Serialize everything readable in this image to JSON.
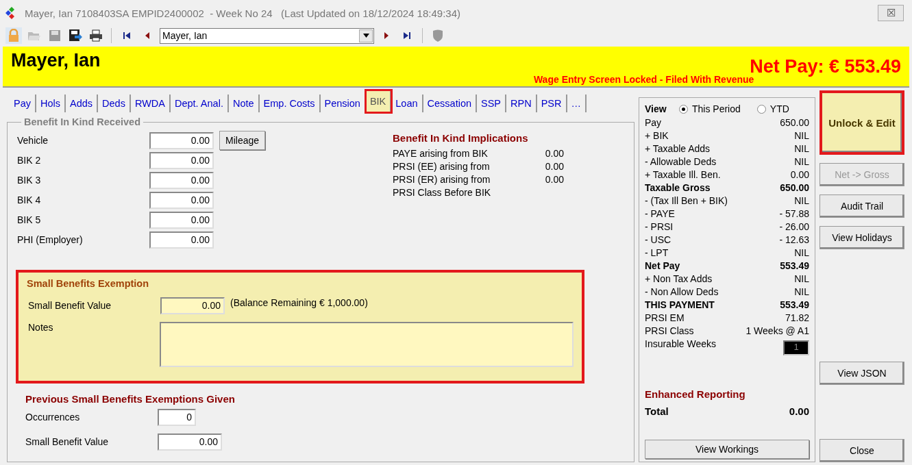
{
  "window": {
    "title": "Mayer, Ian 7108403SA EMPID2400002  - Week No 24   (Last Updated on 18/12/2024 18:49:34)",
    "close": "☒"
  },
  "toolbar": {
    "employee": "Mayer, Ian"
  },
  "banner": {
    "name": "Mayer, Ian",
    "net_pay": "Net Pay: € 553.49",
    "status": "Wage Entry Screen Locked - Filed With Revenue"
  },
  "tabs": [
    {
      "label": "Pay",
      "selected": false,
      "highlighted": false
    },
    {
      "label": "Hols",
      "selected": false,
      "highlighted": false
    },
    {
      "label": "Adds",
      "selected": false,
      "highlighted": false
    },
    {
      "label": "Deds",
      "selected": false,
      "highlighted": false
    },
    {
      "label": "RWDA",
      "selected": false,
      "highlighted": false
    },
    {
      "label": "Dept. Anal.",
      "selected": false,
      "highlighted": false
    },
    {
      "label": "Note",
      "selected": false,
      "highlighted": false
    },
    {
      "label": "Emp. Costs",
      "selected": false,
      "highlighted": false
    },
    {
      "label": "Pension",
      "selected": false,
      "highlighted": false
    },
    {
      "label": "BIK",
      "selected": true,
      "highlighted": true
    },
    {
      "label": "Loan",
      "selected": false,
      "highlighted": false
    },
    {
      "label": "Cessation",
      "selected": false,
      "highlighted": false
    },
    {
      "label": "SSP",
      "selected": false,
      "highlighted": false
    },
    {
      "label": "RPN",
      "selected": false,
      "highlighted": false
    },
    {
      "label": "PSR",
      "selected": false,
      "highlighted": false
    },
    {
      "label": "…",
      "selected": false,
      "highlighted": false
    }
  ],
  "bik_received": {
    "title": "Benefit In Kind Received",
    "rows": [
      {
        "label": "Vehicle",
        "value": "0.00",
        "button": "Mileage"
      },
      {
        "label": "BIK 2",
        "value": "0.00"
      },
      {
        "label": "BIK 3",
        "value": "0.00"
      },
      {
        "label": "BIK 4",
        "value": "0.00"
      },
      {
        "label": "BIK 5",
        "value": "0.00"
      },
      {
        "label": "PHI (Employer)",
        "value": "0.00"
      }
    ]
  },
  "implications": {
    "title": "Benefit In Kind Implications",
    "rows": [
      {
        "label": "PAYE arising from BIK",
        "value": "0.00"
      },
      {
        "label": "PRSI (EE)  arising from",
        "value": "0.00"
      },
      {
        "label": "PRSI (ER) arising from",
        "value": "0.00"
      },
      {
        "label": "PRSI Class Before BIK"
      }
    ]
  },
  "small_benefits": {
    "title": "Small Benefits Exemption",
    "highlighted": true,
    "value_label": "Small Benefit Value",
    "value": "0.00",
    "balance": "(Balance Remaining € 1,000.00)",
    "notes_label": "Notes"
  },
  "previous": {
    "title": "Previous Small Benefits Exemptions Given",
    "rows": [
      {
        "label": "Occurrences",
        "value": "0",
        "kind": "short"
      },
      {
        "label": "Small Benefit Value",
        "value": "0.00",
        "kind": "wide"
      }
    ]
  },
  "summary": {
    "view_label": "View",
    "options": [
      {
        "label": "This Period",
        "selected": true
      },
      {
        "label": "YTD",
        "selected": false
      }
    ],
    "rows": [
      {
        "label": "Pay",
        "value": "650.00",
        "bold": false
      },
      {
        "label": "+ BIK",
        "value": "NIL",
        "bold": false
      },
      {
        "label": "+ Taxable Adds",
        "value": "NIL",
        "bold": false
      },
      {
        "label": "- Allowable Deds",
        "value": "NIL",
        "bold": false
      },
      {
        "label": "+ Taxable Ill. Ben.",
        "value": "0.00",
        "bold": false
      },
      {
        "label": "Taxable Gross",
        "value": "650.00",
        "bold": true
      },
      {
        "label": "- (Tax Ill Ben + BIK)",
        "value": "NIL",
        "bold": false
      },
      {
        "label": "- PAYE",
        "value": "- 57.88",
        "bold": false
      },
      {
        "label": "- PRSI",
        "value": "- 26.00",
        "bold": false
      },
      {
        "label": "- USC",
        "value": "- 12.63",
        "bold": false
      },
      {
        "label": "- LPT",
        "value": "NIL",
        "bold": false
      },
      {
        "label": "Net Pay",
        "value": "553.49",
        "bold": true
      },
      {
        "label": "+ Non Tax Adds",
        "value": "NIL",
        "bold": false
      },
      {
        "label": "- Non Allow Deds",
        "value": "NIL",
        "bold": false
      },
      {
        "label": "THIS PAYMENT",
        "value": "553.49",
        "bold": true
      },
      {
        "label": "PRSI EM",
        "value": "71.82",
        "bold": false
      },
      {
        "label": "PRSI Class",
        "value": "1 Weeks @ A1",
        "bold": false
      },
      {
        "label": "Insurable Weeks",
        "value": "1",
        "bold": false,
        "kind": "box"
      }
    ],
    "enhanced_title": "Enhanced Reporting",
    "total_label": "Total",
    "total_value": "0.00",
    "workings_button": "View Workings"
  },
  "side_buttons": [
    {
      "label": "Unlock & Edit",
      "highlighted": true,
      "disabled": false
    },
    {
      "label": "Net -> Gross",
      "highlighted": false,
      "disabled": true
    },
    {
      "label": "Audit Trail",
      "highlighted": false,
      "disabled": false
    },
    {
      "label": "View Holidays",
      "highlighted": false,
      "disabled": false
    }
  ],
  "json_button": "View JSON",
  "close_button": "Close"
}
